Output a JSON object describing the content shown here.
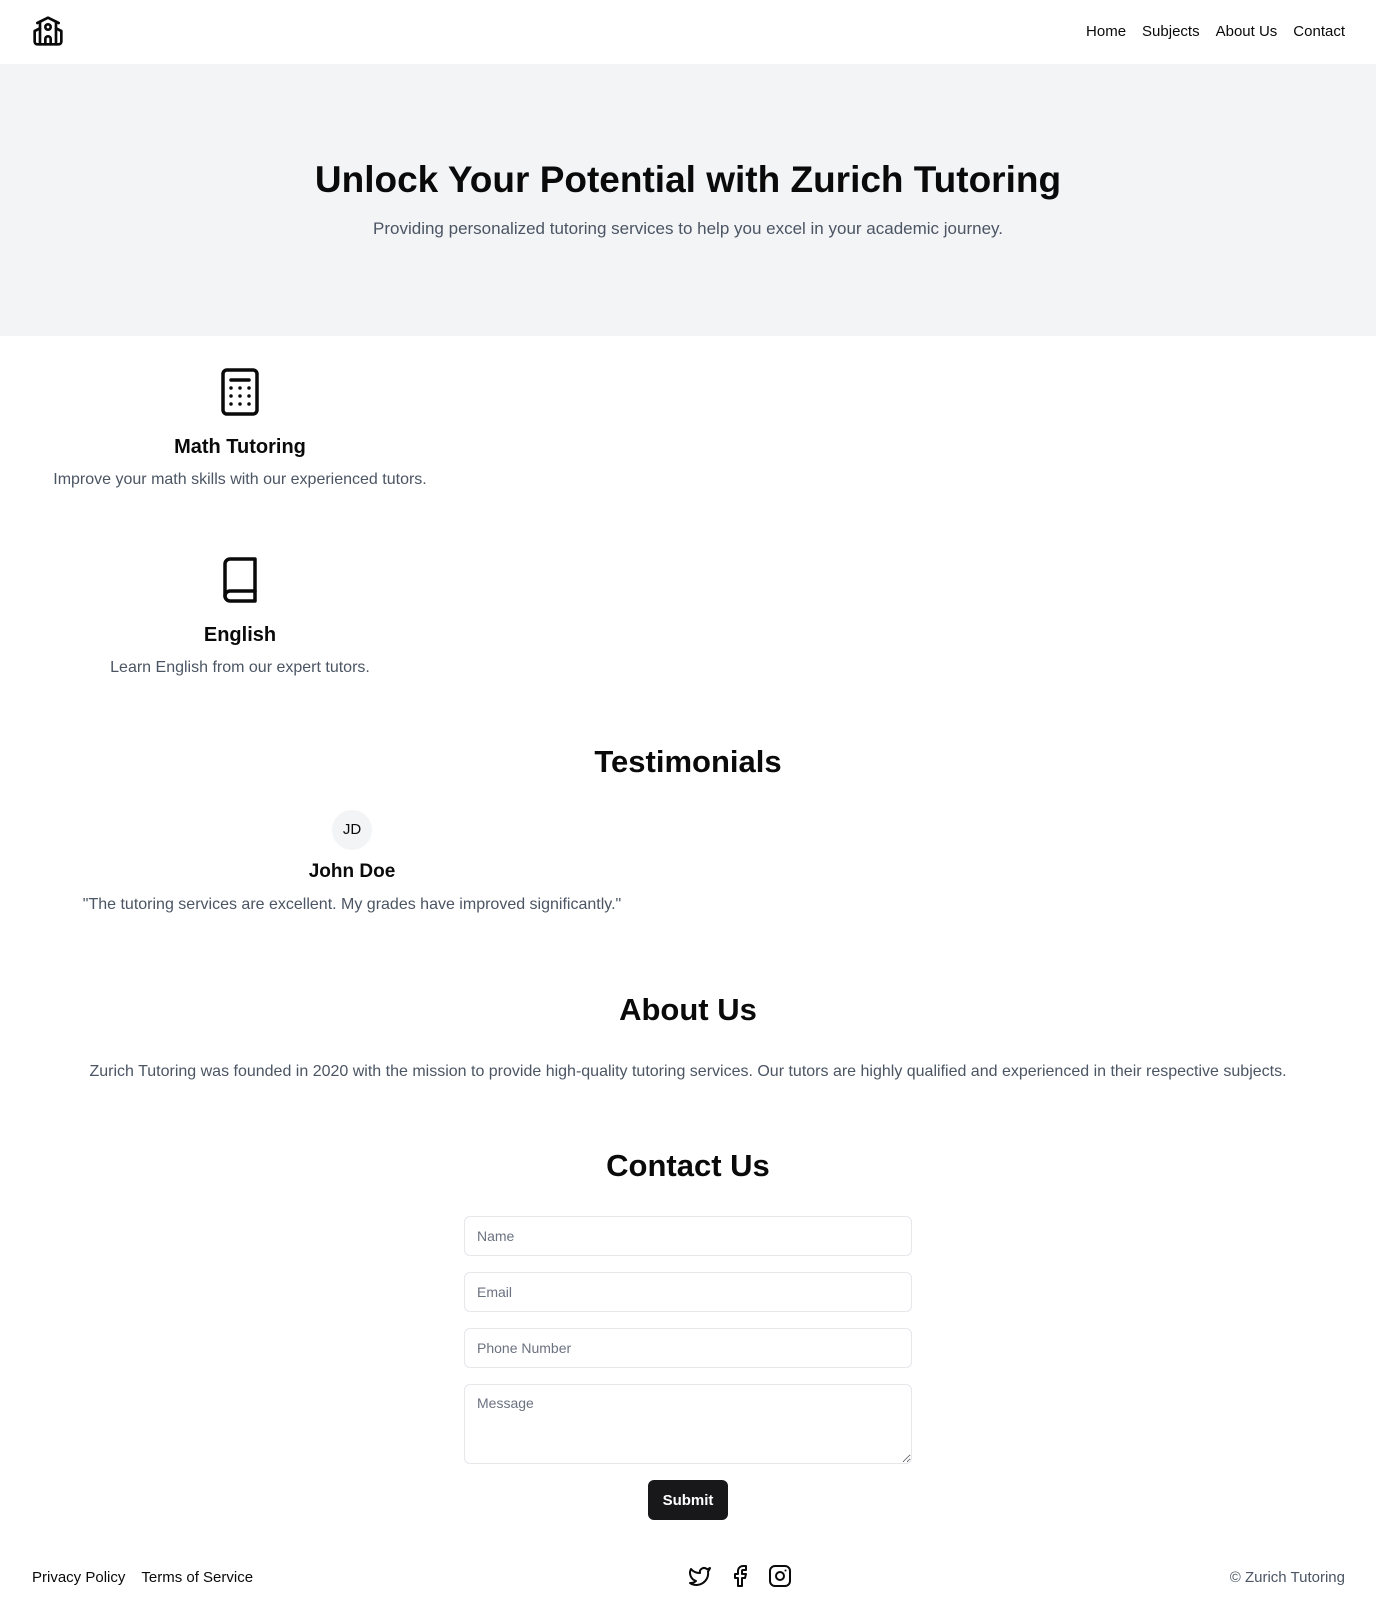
{
  "header": {
    "logo_icon": "school-building-icon",
    "nav": [
      {
        "label": "Home"
      },
      {
        "label": "Subjects"
      },
      {
        "label": "About Us"
      },
      {
        "label": "Contact"
      }
    ]
  },
  "hero": {
    "title": "Unlock Your Potential with Zurich Tutoring",
    "subtitle": "Providing personalized tutoring services to help you excel in your academic journey."
  },
  "subjects": [
    {
      "icon": "calculator-icon",
      "title": "Math Tutoring",
      "description": "Improve your math skills with our experienced tutors."
    },
    {
      "icon": "book-icon",
      "title": "English",
      "description": "Learn English from our expert tutors."
    }
  ],
  "testimonials": {
    "title": "Testimonials",
    "items": [
      {
        "initials": "JD",
        "name": "John Doe",
        "quote": "\"The tutoring services are excellent. My grades have improved significantly.\""
      }
    ]
  },
  "about": {
    "title": "About Us",
    "text": "Zurich Tutoring was founded in 2020 with the mission to provide high-quality tutoring services. Our tutors are highly qualified and experienced in their respective subjects."
  },
  "contact": {
    "title": "Contact Us",
    "name_placeholder": "Name",
    "email_placeholder": "Email",
    "phone_placeholder": "Phone Number",
    "message_placeholder": "Message",
    "submit_label": "Submit"
  },
  "footer": {
    "links": [
      {
        "label": "Privacy Policy"
      },
      {
        "label": "Terms of Service"
      }
    ],
    "socials": [
      "twitter-icon",
      "facebook-icon",
      "instagram-icon"
    ],
    "copyright": "© Zurich Tutoring"
  },
  "colors": {
    "hero_background": "#f3f4f6",
    "muted_text": "#4b5563",
    "button_background": "#18181b"
  }
}
